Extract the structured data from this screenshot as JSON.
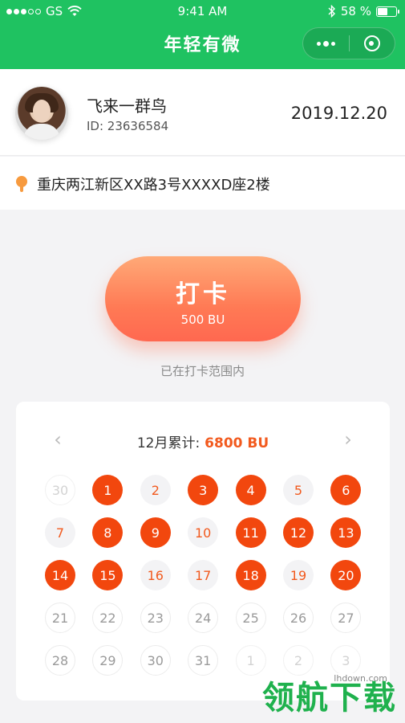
{
  "status_bar": {
    "carrier": "GS",
    "time": "9:41 AM",
    "battery_text": "58 %",
    "battery_level": 0.58
  },
  "nav": {
    "title": "年轻有微"
  },
  "profile": {
    "name": "飞来一群鸟",
    "id_text": "ID: 23636584",
    "date": "2019.12.20"
  },
  "location": {
    "address": "重庆两江新区XX路3号XXXXD座2楼"
  },
  "punch": {
    "label": "打卡",
    "value": "500 BU",
    "range_text": "已在打卡范围内"
  },
  "calendar": {
    "total_label": "12月累计:",
    "total_value": "6800 BU",
    "prev_arrow": "‹",
    "next_arrow": "›",
    "days": [
      {
        "label": "30",
        "state": "other"
      },
      {
        "label": "1",
        "state": "done"
      },
      {
        "label": "2",
        "state": "undone"
      },
      {
        "label": "3",
        "state": "done"
      },
      {
        "label": "4",
        "state": "done"
      },
      {
        "label": "5",
        "state": "undone"
      },
      {
        "label": "6",
        "state": "done"
      },
      {
        "label": "7",
        "state": "undone"
      },
      {
        "label": "8",
        "state": "done"
      },
      {
        "label": "9",
        "state": "done"
      },
      {
        "label": "10",
        "state": "undone"
      },
      {
        "label": "11",
        "state": "done"
      },
      {
        "label": "12",
        "state": "done"
      },
      {
        "label": "13",
        "state": "done"
      },
      {
        "label": "14",
        "state": "done"
      },
      {
        "label": "15",
        "state": "done"
      },
      {
        "label": "16",
        "state": "undone"
      },
      {
        "label": "17",
        "state": "undone"
      },
      {
        "label": "18",
        "state": "done"
      },
      {
        "label": "19",
        "state": "undone"
      },
      {
        "label": "20",
        "state": "done"
      },
      {
        "label": "21",
        "state": "future"
      },
      {
        "label": "22",
        "state": "future"
      },
      {
        "label": "23",
        "state": "future"
      },
      {
        "label": "24",
        "state": "future"
      },
      {
        "label": "25",
        "state": "future"
      },
      {
        "label": "26",
        "state": "future"
      },
      {
        "label": "27",
        "state": "future"
      },
      {
        "label": "28",
        "state": "future"
      },
      {
        "label": "29",
        "state": "future"
      },
      {
        "label": "30",
        "state": "future"
      },
      {
        "label": "31",
        "state": "future"
      },
      {
        "label": "1",
        "state": "other"
      },
      {
        "label": "2",
        "state": "other"
      },
      {
        "label": "3",
        "state": "other"
      }
    ]
  },
  "watermark": {
    "url": "lhdown.com",
    "text": "领航下载"
  },
  "colors": {
    "brand_green": "#1fc261",
    "accent_orange": "#f2470e",
    "button_gradient_top": "#ffa977",
    "button_gradient_bottom": "#ff6850"
  },
  "icons": [
    "wifi-icon",
    "bluetooth-icon",
    "battery-icon",
    "more-icon",
    "close-mini-program-icon",
    "location-pin-icon",
    "chevron-left-icon",
    "chevron-right-icon"
  ]
}
